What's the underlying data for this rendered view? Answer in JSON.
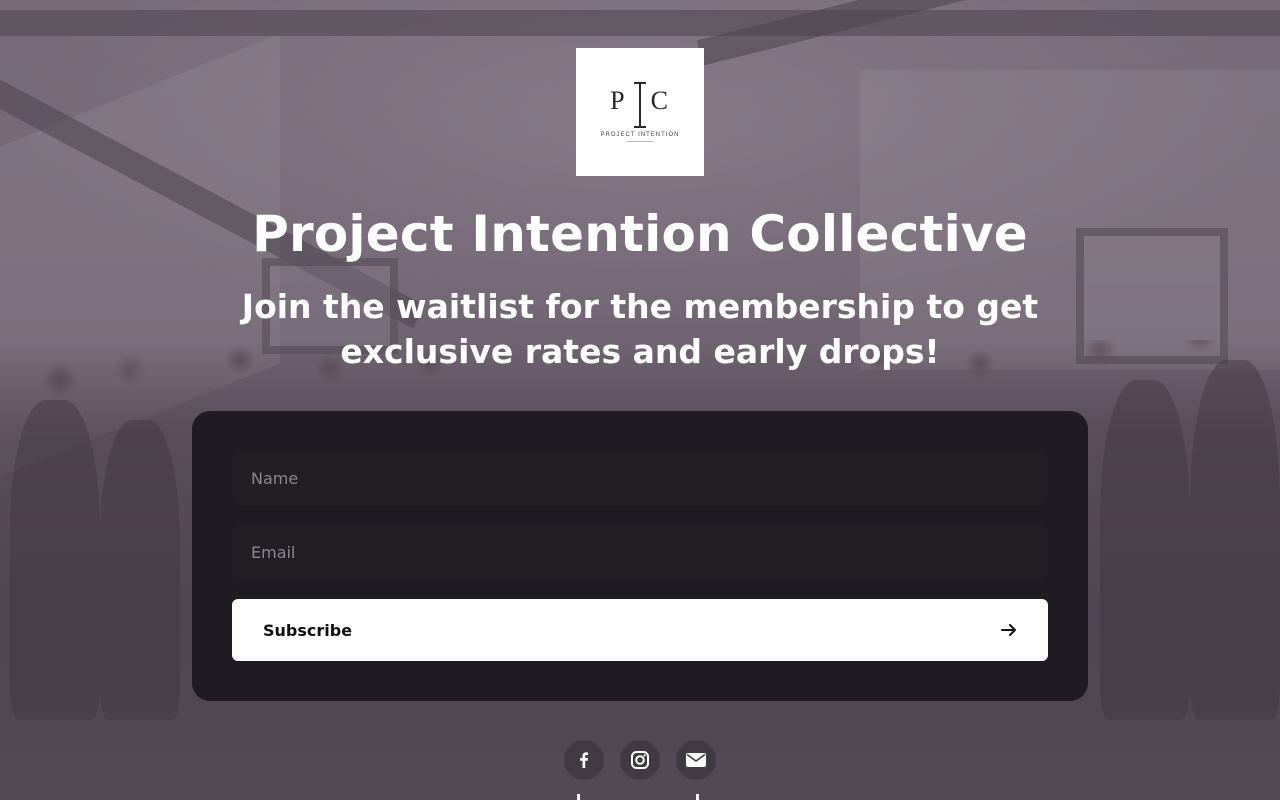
{
  "logo": {
    "initials_left": "P",
    "initials_right": "C",
    "wordmark": "PROJECT INTENTION"
  },
  "hero": {
    "title": "Project Intention Collective",
    "subtitle": "Join the waitlist for the membership to get exclusive rates and early drops!"
  },
  "form": {
    "name_placeholder": "Name",
    "email_placeholder": "Email",
    "subscribe_label": "Subscribe"
  },
  "socials": [
    {
      "name": "facebook-icon"
    },
    {
      "name": "instagram-icon"
    },
    {
      "name": "email-icon"
    }
  ],
  "colors": {
    "card_background": "#1c181e",
    "field_background": "#221e24",
    "button_background": "#ffffff",
    "text": "#ffffff"
  }
}
